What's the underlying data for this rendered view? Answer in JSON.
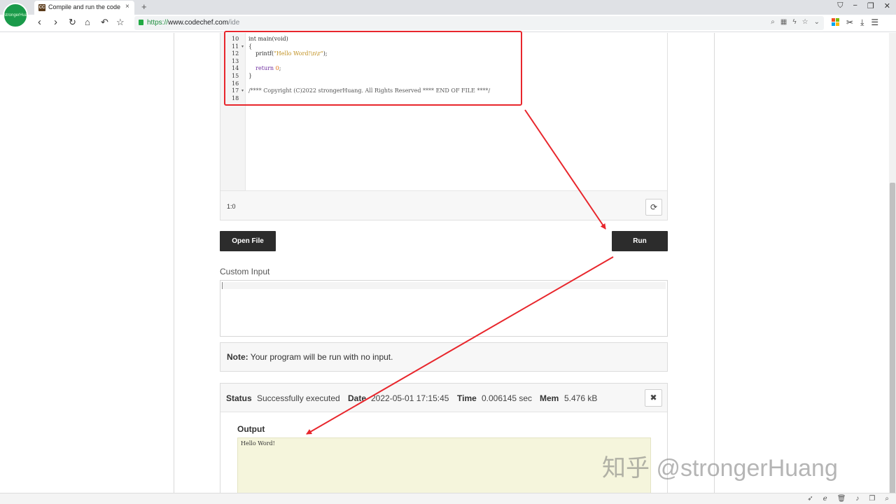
{
  "browser": {
    "avatar_text": "strongerHuang",
    "tab_title": "Compile and run the code",
    "tab_favicon": "CC",
    "tab_close": "×",
    "new_tab": "+",
    "url_protocol": "https://",
    "url_host": "www.codechef.com",
    "url_path": "/ide",
    "accent": "#1e8e3e"
  },
  "editor": {
    "lines": [
      {
        "num": "10",
        "fold": "",
        "code": "int main(void)"
      },
      {
        "num": "11",
        "fold": "▾",
        "code": "{"
      },
      {
        "num": "12",
        "fold": "",
        "code_pre": "    printf(",
        "code_str": "\"Hello Word!\\n\\r\"",
        "code_post": ");"
      },
      {
        "num": "13",
        "fold": "",
        "code": ""
      },
      {
        "num": "14",
        "fold": "",
        "code_ret": "    return ",
        "code_num": "0",
        "code_post": ";"
      },
      {
        "num": "15",
        "fold": "",
        "code": "}"
      },
      {
        "num": "16",
        "fold": "",
        "code": ""
      },
      {
        "num": "17",
        "fold": "▾",
        "code": "/**** Copyright (C)2022 strongerHuang. All Rights Reserved **** END OF FILE ****/"
      },
      {
        "num": "18",
        "fold": "",
        "code": ""
      }
    ],
    "cursor_position": "1:0"
  },
  "buttons": {
    "open_file": "Open File",
    "run": "Run"
  },
  "custom_input": {
    "label": "Custom Input",
    "value": ""
  },
  "note": {
    "label": "Note:",
    "text": " Your program will be run with no input."
  },
  "status": {
    "status_label": "Status",
    "status_value": "Successfully executed",
    "date_label": "Date",
    "date_value": "2022-05-01 17:15:45",
    "time_label": "Time",
    "time_value": "0.006145 sec",
    "mem_label": "Mem",
    "mem_value": "5.476 kB",
    "close": "✖"
  },
  "output": {
    "label": "Output",
    "text": "Hello Word!"
  },
  "watermark": "知乎 @strongerHuang",
  "annotation_color": "#e8262c"
}
